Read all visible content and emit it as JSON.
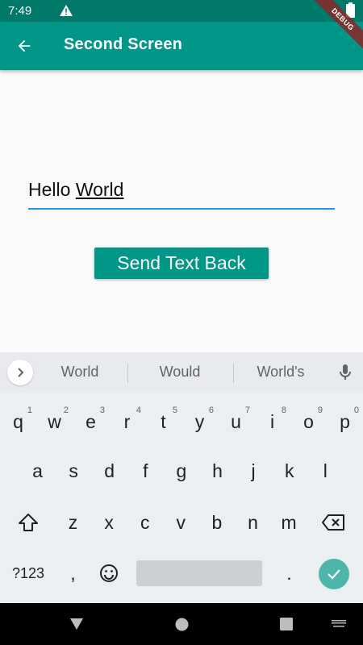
{
  "status_bar": {
    "time": "7:49"
  },
  "debug_banner": "DEBUG",
  "app_bar": {
    "title": "Second Screen"
  },
  "text_field": {
    "value_plain": "Hello ",
    "value_composing": "World"
  },
  "send_button": {
    "label": "Send Text Back"
  },
  "keyboard": {
    "suggestions": [
      "World",
      "Would",
      "World's"
    ],
    "row1": [
      {
        "key": "q",
        "hint": "1"
      },
      {
        "key": "w",
        "hint": "2"
      },
      {
        "key": "e",
        "hint": "3"
      },
      {
        "key": "r",
        "hint": "4"
      },
      {
        "key": "t",
        "hint": "5"
      },
      {
        "key": "y",
        "hint": "6"
      },
      {
        "key": "u",
        "hint": "7"
      },
      {
        "key": "i",
        "hint": "8"
      },
      {
        "key": "o",
        "hint": "9"
      },
      {
        "key": "p",
        "hint": "0"
      }
    ],
    "row2": [
      "a",
      "s",
      "d",
      "f",
      "g",
      "h",
      "j",
      "k",
      "l"
    ],
    "row3": [
      "z",
      "x",
      "c",
      "v",
      "b",
      "n",
      "m"
    ],
    "symbols_key": "?123",
    "comma_key": ",",
    "period_key": "."
  },
  "colors": {
    "app_bar": "#009688",
    "status_bar": "#00796b",
    "button": "#009688",
    "underline": "#2196f3",
    "enter_key": "#4db6ac"
  }
}
